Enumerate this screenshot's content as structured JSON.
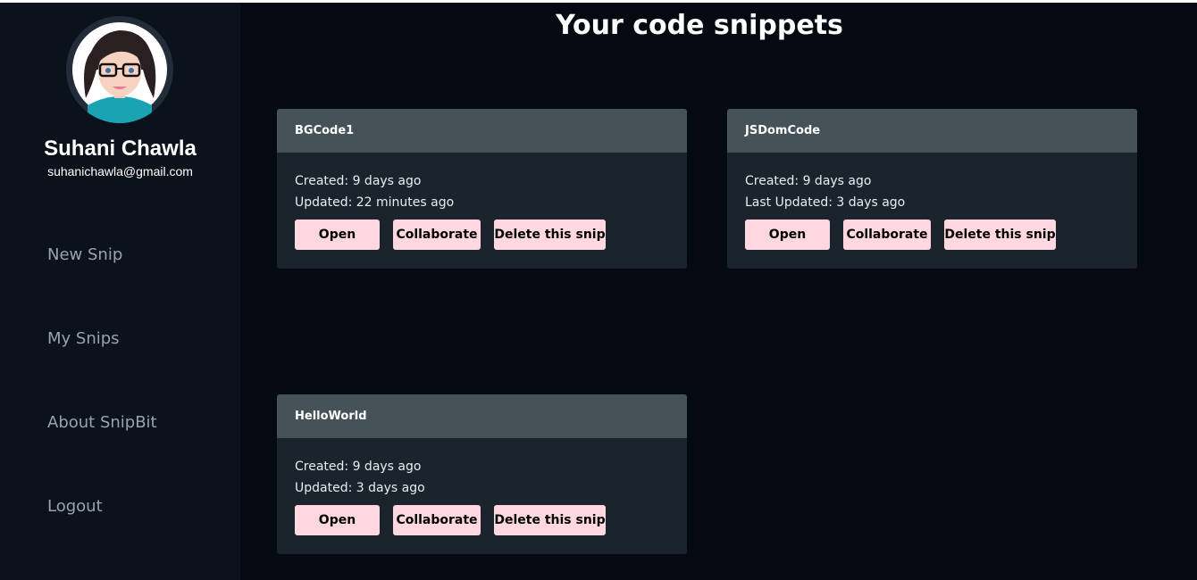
{
  "user": {
    "name": "Suhani Chawla",
    "email": "suhanichawla@gmail.com"
  },
  "sidebar": {
    "items": [
      {
        "label": "New Snip"
      },
      {
        "label": "My Snips"
      },
      {
        "label": "About SnipBit"
      },
      {
        "label": "Logout"
      }
    ]
  },
  "main": {
    "title": "Your code snippets",
    "snippets": [
      {
        "name": "BGCode1",
        "created": "Created: 9 days ago",
        "updated": "Updated: 22 minutes ago"
      },
      {
        "name": "JSDomCode",
        "created": "Created: 9 days ago",
        "updated": "Last Updated: 3 days ago"
      },
      {
        "name": "HelloWorld",
        "created": "Created: 9 days ago",
        "updated": "Updated: 3 days ago"
      }
    ]
  },
  "buttons": {
    "open": "Open",
    "collaborate": "Collaborate",
    "delete": "Delete this snip"
  },
  "colors": {
    "background": "#050a12",
    "sidebar": "#0b121c",
    "card": "#1b232c",
    "card_header": "#455359",
    "button": "#ffd8df"
  },
  "icons": {
    "avatar": "cartoon-woman-with-glasses-avatar"
  }
}
